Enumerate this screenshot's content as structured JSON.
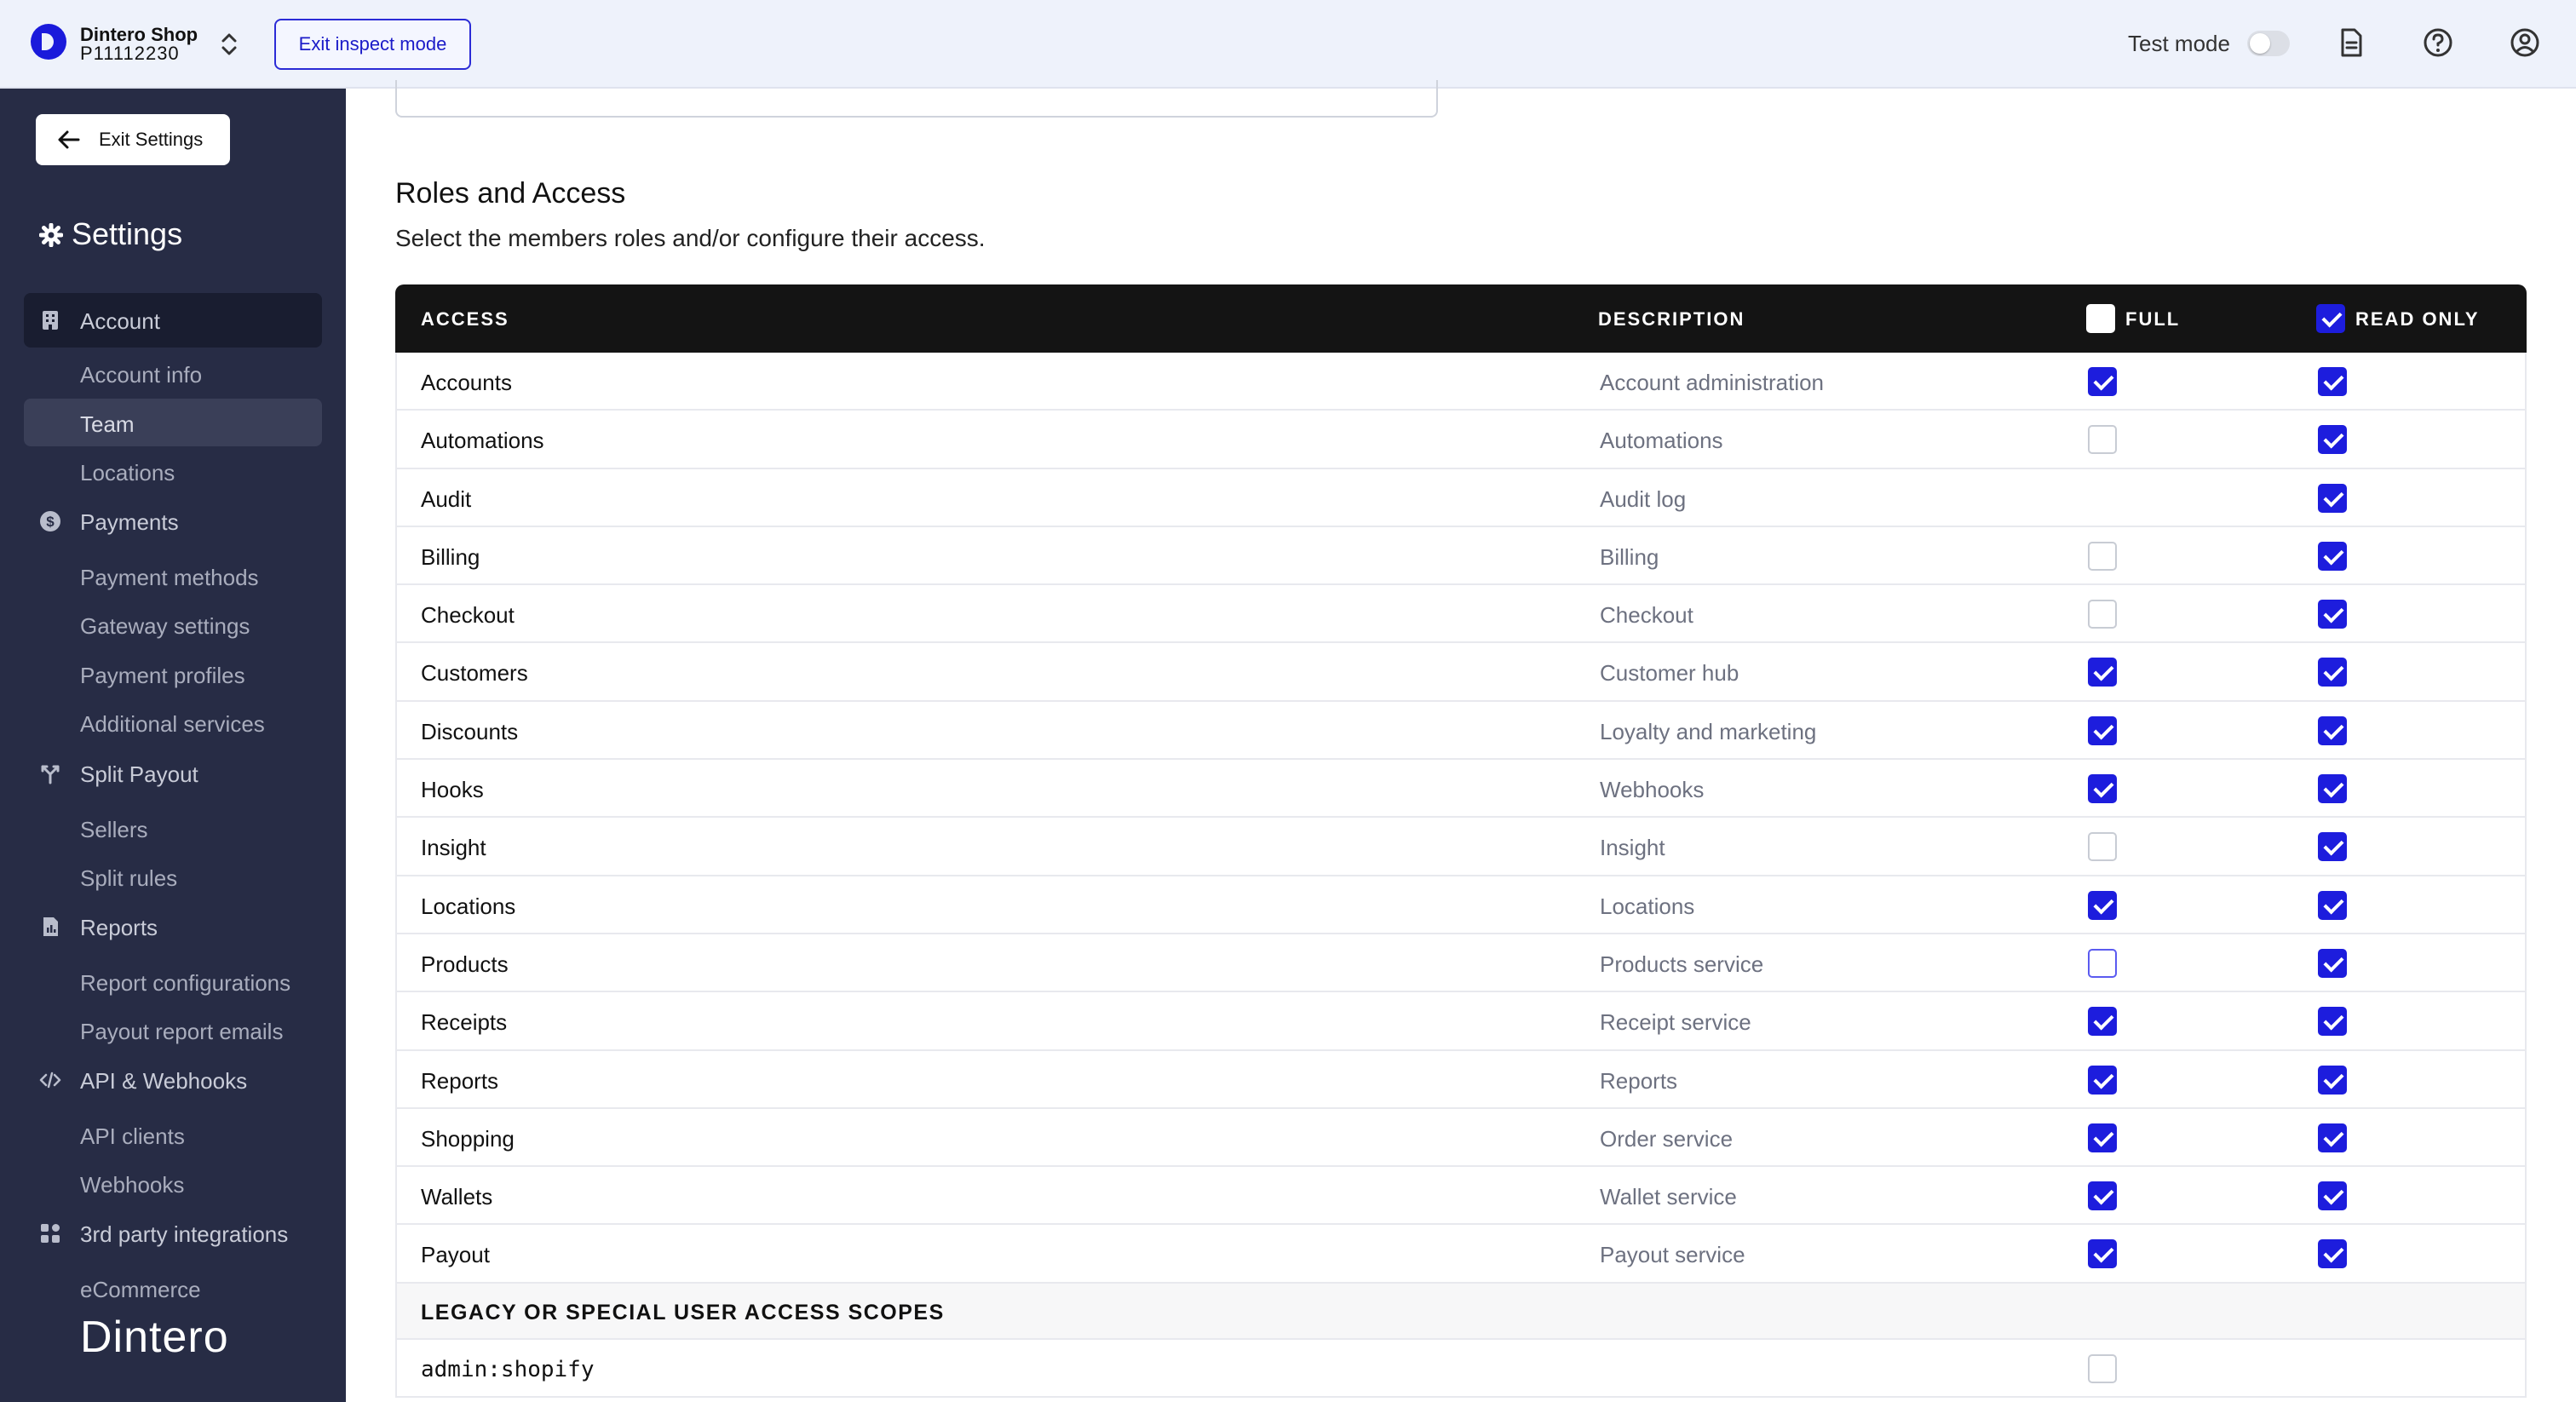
{
  "header": {
    "shop_name": "Dintero Shop",
    "shop_id": "P11112230",
    "inspect_button": "Exit inspect mode",
    "test_mode_label": "Test mode",
    "test_mode_on": false,
    "icons": [
      "logo-icon",
      "chevron-updown-icon",
      "document-icon",
      "help-icon",
      "user-icon"
    ]
  },
  "sidebar": {
    "exit_settings": "Exit Settings",
    "title": "Settings",
    "sections": [
      {
        "label": "Account",
        "icon": "building-icon",
        "active": true,
        "items": [
          {
            "label": "Account info"
          },
          {
            "label": "Team",
            "active": true
          },
          {
            "label": "Locations"
          }
        ]
      },
      {
        "label": "Payments",
        "icon": "dollar-icon",
        "items": [
          {
            "label": "Payment methods"
          },
          {
            "label": "Gateway settings"
          },
          {
            "label": "Payment profiles"
          },
          {
            "label": "Additional services"
          }
        ]
      },
      {
        "label": "Split Payout",
        "icon": "split-icon",
        "items": [
          {
            "label": "Sellers"
          },
          {
            "label": "Split rules"
          }
        ]
      },
      {
        "label": "Reports",
        "icon": "report-icon",
        "items": [
          {
            "label": "Report configurations"
          },
          {
            "label": "Payout report emails"
          }
        ]
      },
      {
        "label": "API & Webhooks",
        "icon": "code-icon",
        "items": [
          {
            "label": "API clients"
          },
          {
            "label": "Webhooks"
          }
        ]
      },
      {
        "label": "3rd party integrations",
        "icon": "grid-icon",
        "items": [
          {
            "label": "eCommerce"
          }
        ]
      }
    ],
    "brand": "Dintero"
  },
  "main": {
    "section_title": "Roles and Access",
    "section_subtitle": "Select the members roles and/or configure their access.",
    "table": {
      "headers": {
        "access": "ACCESS",
        "description": "DESCRIPTION",
        "full": "FULL",
        "read_only": "READ ONLY"
      },
      "header_full_checked": false,
      "header_read_only_checked": true,
      "rows": [
        {
          "access": "Accounts",
          "description": "Account administration",
          "full": true,
          "read_only": true
        },
        {
          "access": "Automations",
          "description": "Automations",
          "full": false,
          "read_only": true
        },
        {
          "access": "Audit",
          "description": "Audit log",
          "full": null,
          "read_only": true
        },
        {
          "access": "Billing",
          "description": "Billing",
          "full": false,
          "read_only": true
        },
        {
          "access": "Checkout",
          "description": "Checkout",
          "full": false,
          "read_only": true
        },
        {
          "access": "Customers",
          "description": "Customer hub",
          "full": true,
          "read_only": true
        },
        {
          "access": "Discounts",
          "description": "Loyalty and marketing",
          "full": true,
          "read_only": true
        },
        {
          "access": "Hooks",
          "description": "Webhooks",
          "full": true,
          "read_only": true
        },
        {
          "access": "Insight",
          "description": "Insight",
          "full": false,
          "read_only": true
        },
        {
          "access": "Locations",
          "description": "Locations",
          "full": true,
          "read_only": true
        },
        {
          "access": "Products",
          "description": "Products service",
          "full": false,
          "full_focused": true,
          "read_only": true
        },
        {
          "access": "Receipts",
          "description": "Receipt service",
          "full": true,
          "read_only": true
        },
        {
          "access": "Reports",
          "description": "Reports",
          "full": true,
          "read_only": true
        },
        {
          "access": "Shopping",
          "description": "Order service",
          "full": true,
          "read_only": true
        },
        {
          "access": "Wallets",
          "description": "Wallet service",
          "full": true,
          "read_only": true
        },
        {
          "access": "Payout",
          "description": "Payout service",
          "full": true,
          "read_only": true
        }
      ],
      "legacy_label": "LEGACY OR SPECIAL USER ACCESS SCOPES",
      "legacy_rows": [
        {
          "access": "admin:shopify",
          "description": "",
          "full": false
        }
      ]
    }
  }
}
